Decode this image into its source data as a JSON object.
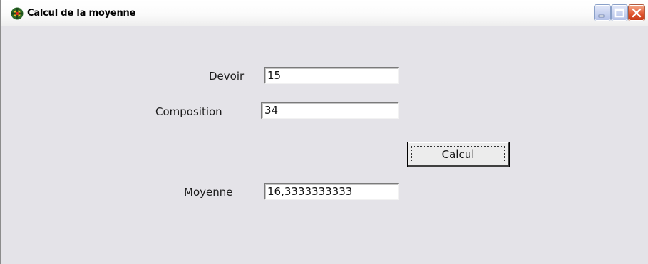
{
  "window": {
    "title": "Calcul de la moyenne",
    "icon": "delphi-app-icon",
    "controls": {
      "minimize_icon": "minimize-icon",
      "maximize_icon": "maximize-icon",
      "close_icon": "close-icon"
    }
  },
  "form": {
    "devoir_label": "Devoir",
    "devoir_value": "15",
    "composition_label": "Composition",
    "composition_value": "34",
    "calcul_button_label": "Calcul",
    "moyenne_label": "Moyenne",
    "moyenne_value": "16,3333333333"
  },
  "colors": {
    "client_background": "#e4e3e8",
    "close_button": "#e0532e",
    "caption_buttons": "#b4c2e8"
  }
}
